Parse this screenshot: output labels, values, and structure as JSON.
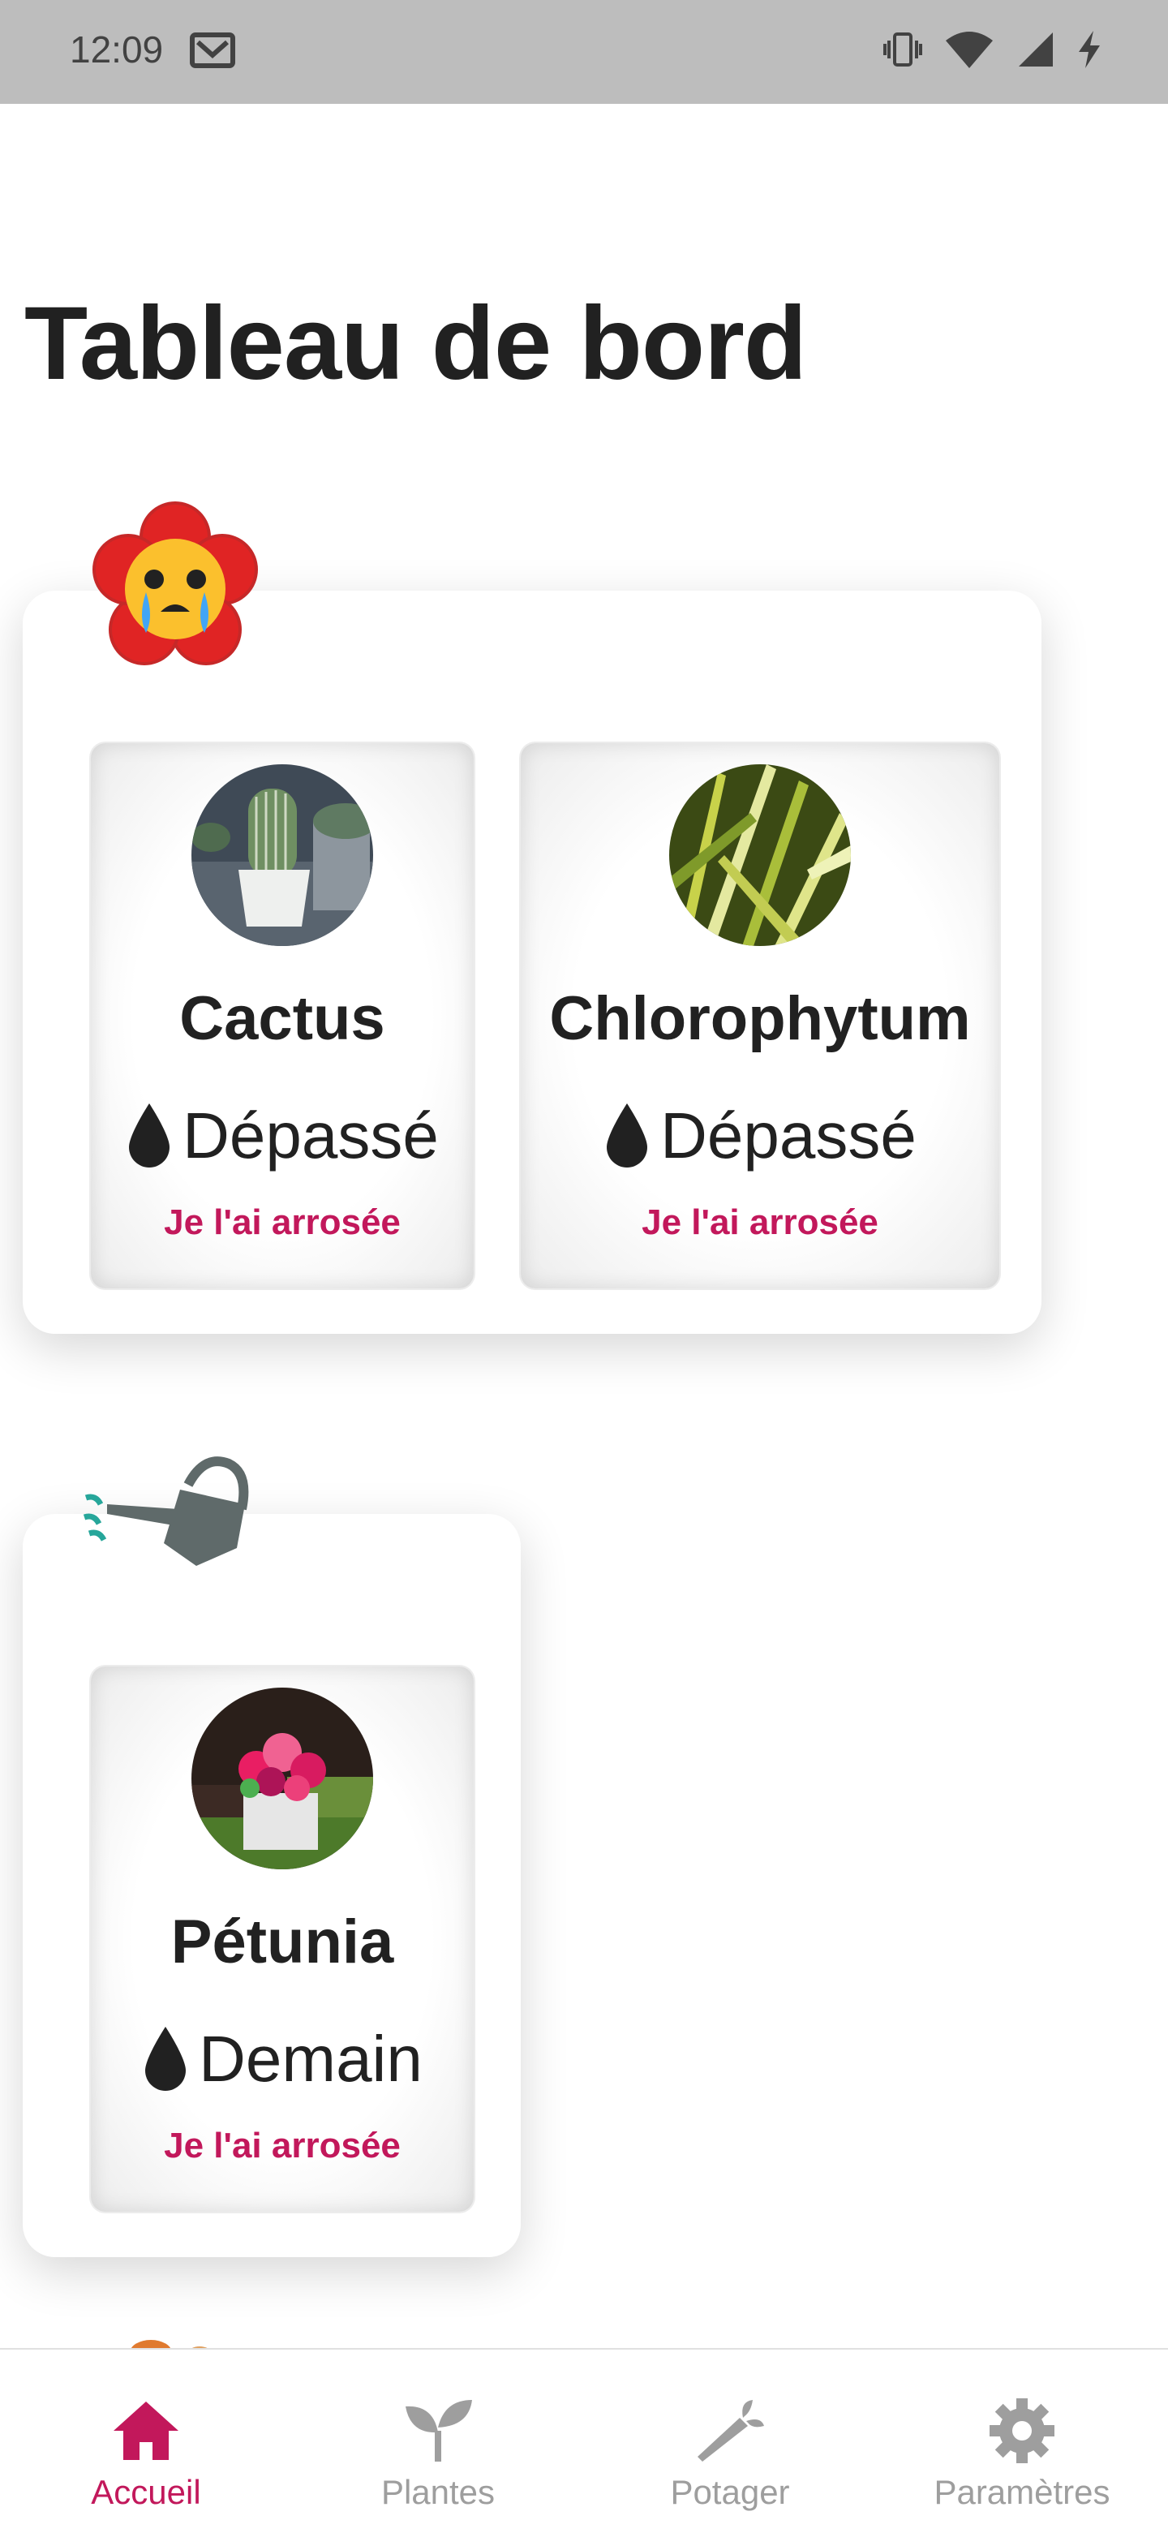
{
  "status_bar": {
    "time": "12:09"
  },
  "page": {
    "title": "Tableau de bord"
  },
  "groups": [
    {
      "icon": "crying-flower-icon",
      "plants": [
        {
          "name": "Cactus",
          "status": "Dépassé",
          "action": "Je l'ai arrosée"
        },
        {
          "name": "Chlorophytum",
          "status": "Dépassé",
          "action": "Je l'ai arrosée"
        }
      ]
    },
    {
      "icon": "watering-can-icon",
      "plants": [
        {
          "name": "Pétunia",
          "status": "Demain",
          "action": "Je l'ai arrosée"
        }
      ]
    }
  ],
  "nav": {
    "items": [
      {
        "label": "Accueil",
        "icon": "home-icon",
        "active": true
      },
      {
        "label": "Plantes",
        "icon": "sprout-icon",
        "active": false
      },
      {
        "label": "Potager",
        "icon": "carrot-icon",
        "active": false
      },
      {
        "label": "Paramètres",
        "icon": "gear-icon",
        "active": false
      }
    ]
  },
  "colors": {
    "accent": "#c2185b",
    "inactive": "#9e9e9e",
    "status_bar": "#bdbdbd"
  }
}
